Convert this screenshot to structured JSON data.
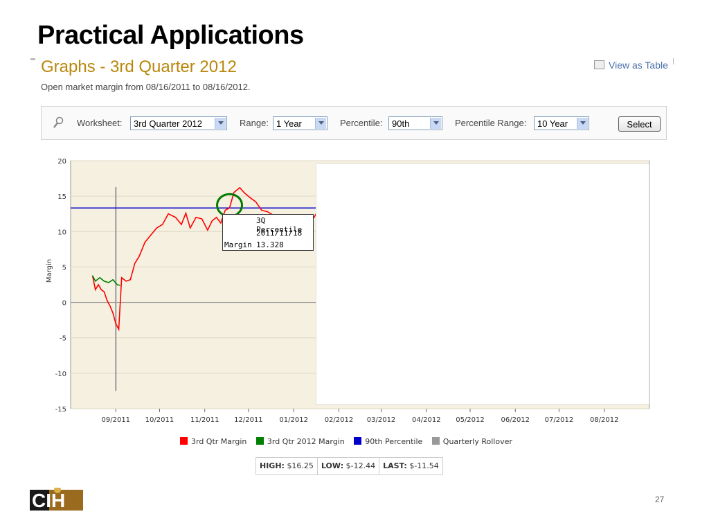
{
  "slide": {
    "title": "Practical Applications",
    "page_number": "27"
  },
  "page": {
    "heading": "Graphs - 3rd Quarter 2012",
    "view_as_table": "View as Table",
    "subtitle": "Open market margin from 08/16/2011 to 08/16/2012."
  },
  "toolbar": {
    "worksheet_label": "Worksheet:",
    "worksheet_value": "3rd Quarter 2012",
    "range_label": "Range:",
    "range_value": "1 Year",
    "percentile_label": "Percentile:",
    "percentile_value": "90th",
    "percentile_range_label": "Percentile Range:",
    "percentile_range_value": "10 Year",
    "select_label": "Select"
  },
  "tooltip": {
    "line1": "3Q Percentile",
    "line2": "2011/11/18",
    "line3_label": "Margin",
    "line3_value": "13.328"
  },
  "stats": {
    "high_label": "HIGH:",
    "high_value": "$16.25",
    "low_label": "LOW:",
    "low_value": "$-12.44",
    "last_label": "LAST:",
    "last_value": "$-11.54"
  },
  "logo": {
    "text": "CIH"
  },
  "colors": {
    "heading": "#b8860b",
    "link": "#4b6ea9",
    "plot_bg": "#f5f0e0",
    "series_red": "#ff0000",
    "series_green": "#008000",
    "series_blue": "#0000cc",
    "rollover_gray": "#999999",
    "highlight_circle": "#007a00"
  },
  "icons": {
    "search": "magnifier-icon",
    "dropdown": "chevron-down-icon",
    "table": "table-icon"
  },
  "chart_data": {
    "type": "line",
    "xlabel": "",
    "ylabel": "Margin",
    "ylim": [
      -15,
      20
    ],
    "y_ticks": [
      -15,
      -10,
      -5,
      0,
      5,
      10,
      15,
      20
    ],
    "x_tick_labels": [
      "09/2011",
      "10/2011",
      "11/2011",
      "12/2011",
      "01/2012",
      "02/2012",
      "03/2012",
      "04/2012",
      "05/2012",
      "06/2012",
      "07/2012",
      "08/2012"
    ],
    "series": [
      {
        "name": "3rd Qtr Margin",
        "color": "#ff0000",
        "points": [
          [
            "2011-08-16",
            3.8
          ],
          [
            "2011-08-18",
            1.8
          ],
          [
            "2011-08-20",
            2.5
          ],
          [
            "2011-08-22",
            1.8
          ],
          [
            "2011-08-24",
            1.5
          ],
          [
            "2011-08-26",
            0.3
          ],
          [
            "2011-08-28",
            -0.5
          ],
          [
            "2011-08-30",
            -1.5
          ],
          [
            "2011-09-01",
            -3.0
          ],
          [
            "2011-09-03",
            -3.8
          ],
          [
            "2011-09-05",
            3.5
          ],
          [
            "2011-09-08",
            3.0
          ],
          [
            "2011-09-11",
            3.2
          ],
          [
            "2011-09-14",
            5.5
          ],
          [
            "2011-09-17",
            6.5
          ],
          [
            "2011-09-21",
            8.5
          ],
          [
            "2011-09-25",
            9.5
          ],
          [
            "2011-09-29",
            10.5
          ],
          [
            "2011-10-03",
            11.0
          ],
          [
            "2011-10-07",
            12.5
          ],
          [
            "2011-10-12",
            12.0
          ],
          [
            "2011-10-16",
            11.0
          ],
          [
            "2011-10-19",
            12.6
          ],
          [
            "2011-10-22",
            10.5
          ],
          [
            "2011-10-26",
            12.0
          ],
          [
            "2011-10-30",
            11.8
          ],
          [
            "2011-11-03",
            10.2
          ],
          [
            "2011-11-06",
            11.5
          ],
          [
            "2011-11-09",
            12.0
          ],
          [
            "2011-11-12",
            11.2
          ],
          [
            "2011-11-15",
            13.0
          ],
          [
            "2011-11-18",
            13.328
          ],
          [
            "2011-11-21",
            15.5
          ],
          [
            "2011-11-25",
            16.2
          ],
          [
            "2011-11-28",
            15.5
          ],
          [
            "2011-12-02",
            14.8
          ],
          [
            "2011-12-06",
            14.2
          ],
          [
            "2011-12-10",
            13.0
          ],
          [
            "2011-12-14",
            12.8
          ],
          [
            "2011-12-19",
            12.2
          ],
          [
            "2011-12-24",
            11.6
          ],
          [
            "2011-12-30",
            11.0
          ],
          [
            "2012-01-05",
            10.8
          ],
          [
            "2012-01-10",
            11.2
          ],
          [
            "2012-01-15",
            12.0
          ],
          [
            "2012-01-19",
            13.5
          ],
          [
            "2012-01-22",
            13.2
          ],
          [
            "2012-01-25",
            14.2
          ],
          [
            "2012-01-27",
            13.2
          ]
        ]
      },
      {
        "name": "3rd Qtr 2012 Margin",
        "color": "#008000",
        "points": [
          [
            "2011-08-16",
            3.8
          ],
          [
            "2011-08-18",
            3.0
          ],
          [
            "2011-08-21",
            3.5
          ],
          [
            "2011-08-24",
            3.0
          ],
          [
            "2011-08-27",
            2.8
          ],
          [
            "2011-08-30",
            3.2
          ],
          [
            "2011-09-02",
            2.5
          ],
          [
            "2011-09-04",
            2.4
          ]
        ]
      },
      {
        "name": "90th Percentile",
        "color": "#0000cc",
        "value": 13.328
      },
      {
        "name": "Quarterly Rollover",
        "color": "#999999",
        "x": "2011-09-01"
      }
    ],
    "annotations": [
      {
        "label": "3Q Percentile",
        "x": "2011-11-18",
        "y": 13.328
      }
    ]
  }
}
